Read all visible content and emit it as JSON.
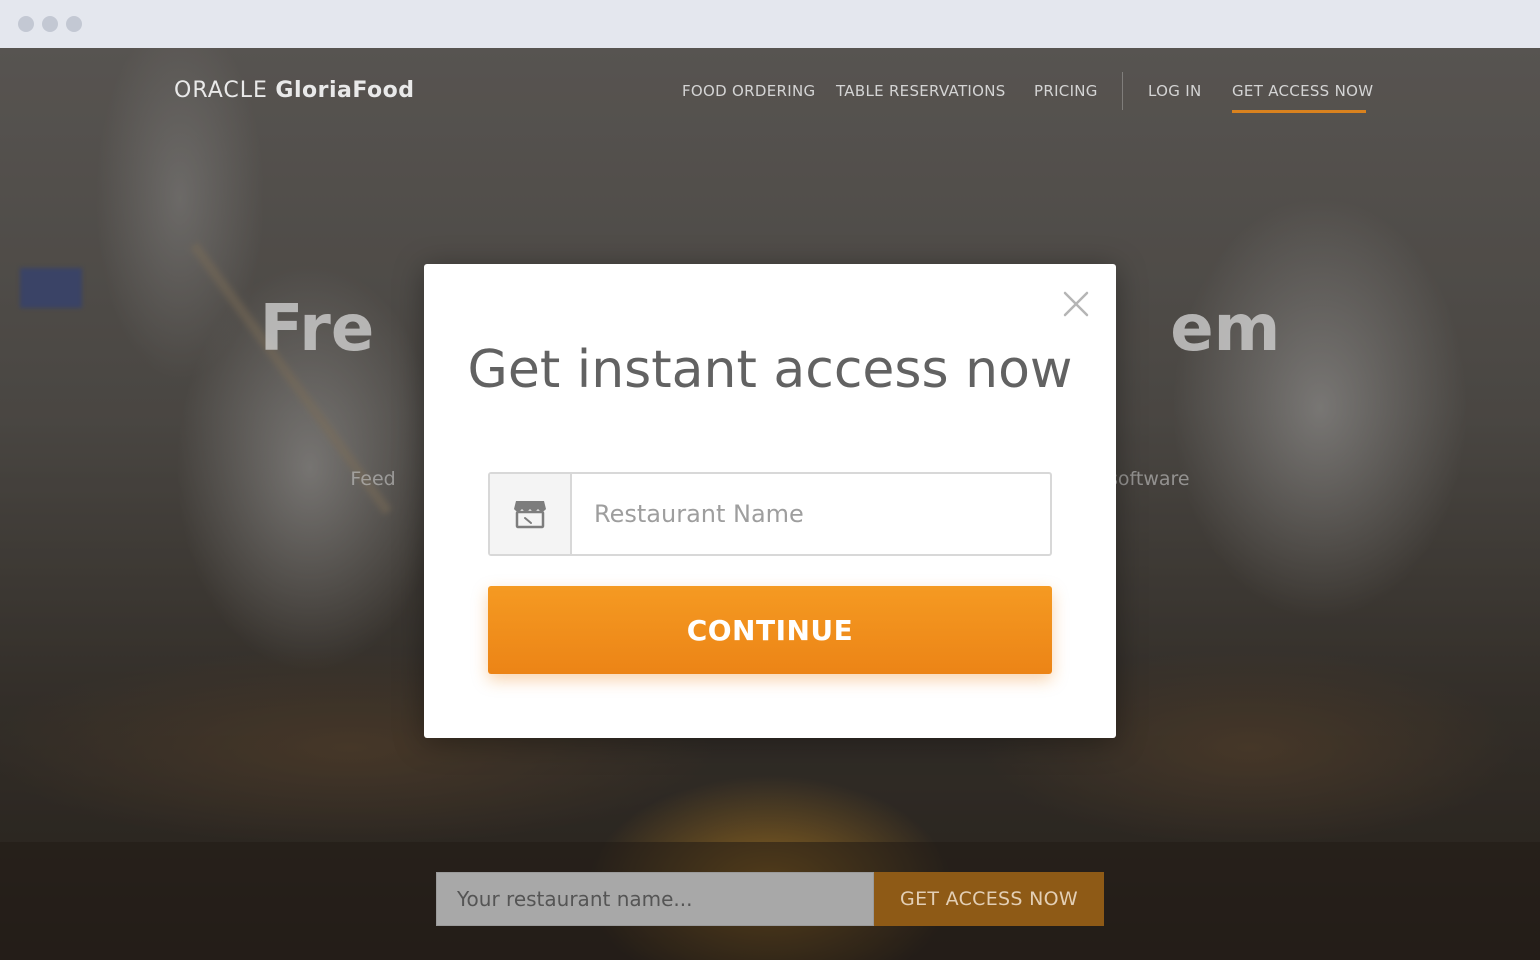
{
  "nav": {
    "logo_oracle": "ORACLE",
    "logo_gloria": "GloriaFood",
    "links": [
      {
        "label": "FOOD ORDERING"
      },
      {
        "label": "TABLE RESERVATIONS"
      },
      {
        "label": "PRICING"
      },
      {
        "label": "LOG IN"
      },
      {
        "label": "GET ACCESS NOW"
      }
    ],
    "active_color": "#d9821e"
  },
  "hero": {
    "title_left": "Fre",
    "title_right": "em",
    "subtitle_left": "Feed",
    "subtitle_right": "em software"
  },
  "modal": {
    "title": "Get instant access now",
    "field_icon": "storefront-icon",
    "field_placeholder": "Restaurant Name",
    "continue_label": "CONTINUE",
    "close_icon": "close-icon",
    "accent_color": "#f28c1c"
  },
  "bottom_bar": {
    "input_text": "Your restaurant name...",
    "button_label": "GET ACCESS NOW"
  }
}
